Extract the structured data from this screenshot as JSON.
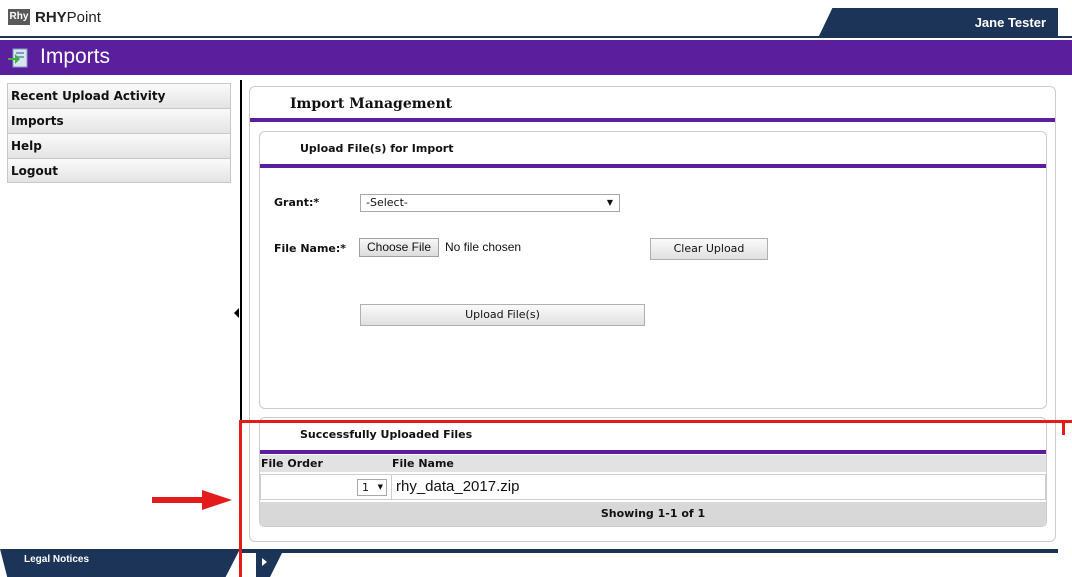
{
  "app": {
    "logo_badge": "Rhy",
    "logo_bold": "RHY",
    "logo_rest": "Point",
    "user": "Jane Tester"
  },
  "page": {
    "title": "Imports"
  },
  "sidebar": {
    "items": [
      {
        "label": "Recent Upload Activity"
      },
      {
        "label": "Imports"
      },
      {
        "label": "Help"
      },
      {
        "label": "Logout"
      }
    ]
  },
  "main": {
    "title": "Import Management",
    "upload": {
      "title": "Upload File(s) for Import",
      "grant_label": "Grant:*",
      "grant_value": "-Select-",
      "file_label": "File Name:*",
      "choose_label": "Choose File",
      "no_file_text": "No file chosen",
      "clear_label": "Clear Upload",
      "upload_label": "Upload File(s)"
    },
    "files": {
      "title": "Successfully Uploaded Files",
      "columns": [
        "File Order",
        "File Name"
      ],
      "rows": [
        {
          "order": "1",
          "name": "rhy_data_2017.zip"
        }
      ],
      "footer": "Showing 1-1 of 1"
    }
  },
  "footer": {
    "legal": "Legal Notices"
  },
  "colors": {
    "brand_purple": "#5b1f9e",
    "navy": "#1c3458",
    "highlight_red": "#e31b1b"
  }
}
